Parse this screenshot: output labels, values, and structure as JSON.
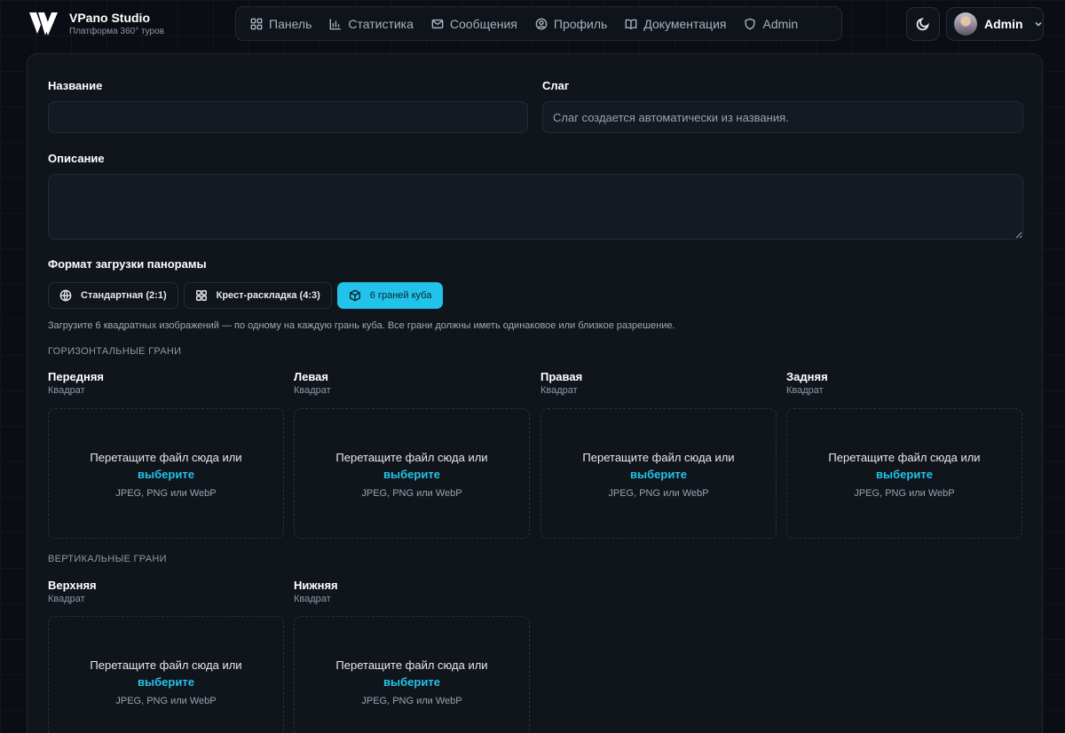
{
  "brand": {
    "name": "VPano Studio",
    "subtitle": "Платформа 360° туров"
  },
  "nav": {
    "items": [
      {
        "label": "Панель",
        "icon": "dashboard-icon"
      },
      {
        "label": "Статистика",
        "icon": "bar-chart-icon"
      },
      {
        "label": "Сообщения",
        "icon": "mail-icon"
      },
      {
        "label": "Профиль",
        "icon": "user-circle-icon"
      },
      {
        "label": "Документация",
        "icon": "book-icon"
      },
      {
        "label": "Admin",
        "icon": "shield-icon"
      }
    ]
  },
  "user": {
    "name": "Admin"
  },
  "form": {
    "title_label": "Название",
    "title_value": "",
    "slug_label": "Слаг",
    "slug_placeholder": "Слаг создается автоматически из названия.",
    "description_label": "Описание",
    "description_value": "",
    "format_label": "Формат загрузки панорамы",
    "formats": [
      {
        "label": "Стандартная (2:1)",
        "icon": "globe-icon",
        "active": false
      },
      {
        "label": "Крест-раскладка (4:3)",
        "icon": "grid-icon",
        "active": false
      },
      {
        "label": "6 граней куба",
        "icon": "cube-icon",
        "active": true
      }
    ],
    "hint": "Загрузите 6 квадратных изображений — по одному на каждую грань куба. Все грани должны иметь одинаковое или близкое разрешение."
  },
  "upload": {
    "drop_text": "Перетащите файл сюда или",
    "drop_link": "выберите",
    "drop_formats": "JPEG, PNG или WebP"
  },
  "sections": {
    "horizontal": {
      "title": "ГОРИЗОНТАЛЬНЫЕ ГРАНИ",
      "faces": [
        {
          "name": "Передняя",
          "sub": "Квадрат"
        },
        {
          "name": "Левая",
          "sub": "Квадрат"
        },
        {
          "name": "Правая",
          "sub": "Квадрат"
        },
        {
          "name": "Задняя",
          "sub": "Квадрат"
        }
      ]
    },
    "vertical": {
      "title": "ВЕРТИКАЛЬНЫЕ ГРАНИ",
      "faces": [
        {
          "name": "Верхняя",
          "sub": "Квадрат"
        },
        {
          "name": "Нижняя",
          "sub": "Квадрат"
        }
      ]
    }
  },
  "colors": {
    "accent": "#22c3ea",
    "background": "#0a0d13",
    "card": "#10141b"
  }
}
